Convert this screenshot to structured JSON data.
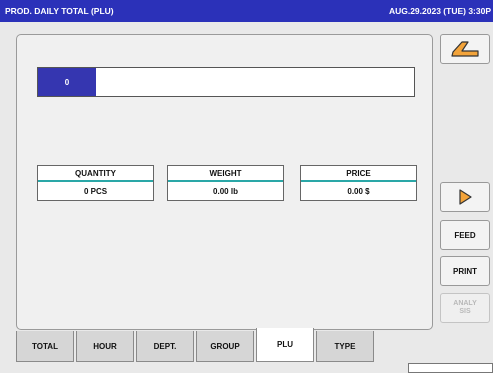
{
  "header": {
    "title": "PROD. DAILY TOTAL (PLU)",
    "datetime": "AUG.29.2023 (TUE)  3:30P"
  },
  "plu_input": {
    "value": "0"
  },
  "stats": [
    {
      "label": "QUANTITY",
      "value": "0 PCS"
    },
    {
      "label": "WEIGHT",
      "value": "0.00 lb"
    },
    {
      "label": "PRICE",
      "value": "0.00 $"
    }
  ],
  "side_buttons": {
    "back_icon": "return-arrow-icon",
    "next_icon": "play-triangle-icon",
    "feed": "FEED",
    "print": "PRINT",
    "analysis_line1": "ANALY",
    "analysis_line2": "SIS"
  },
  "tabs": [
    {
      "label": "TOTAL",
      "active": false
    },
    {
      "label": "HOUR",
      "active": false
    },
    {
      "label": "DEPT.",
      "active": false
    },
    {
      "label": "GROUP",
      "active": false
    },
    {
      "label": "PLU",
      "active": true
    },
    {
      "label": "TYPE",
      "active": false
    }
  ],
  "colors": {
    "titlebar": "#2b31b9",
    "accent_number": "#3536b0",
    "divider_teal": "#2aa7a7",
    "icon_orange": "#f2a33a"
  }
}
